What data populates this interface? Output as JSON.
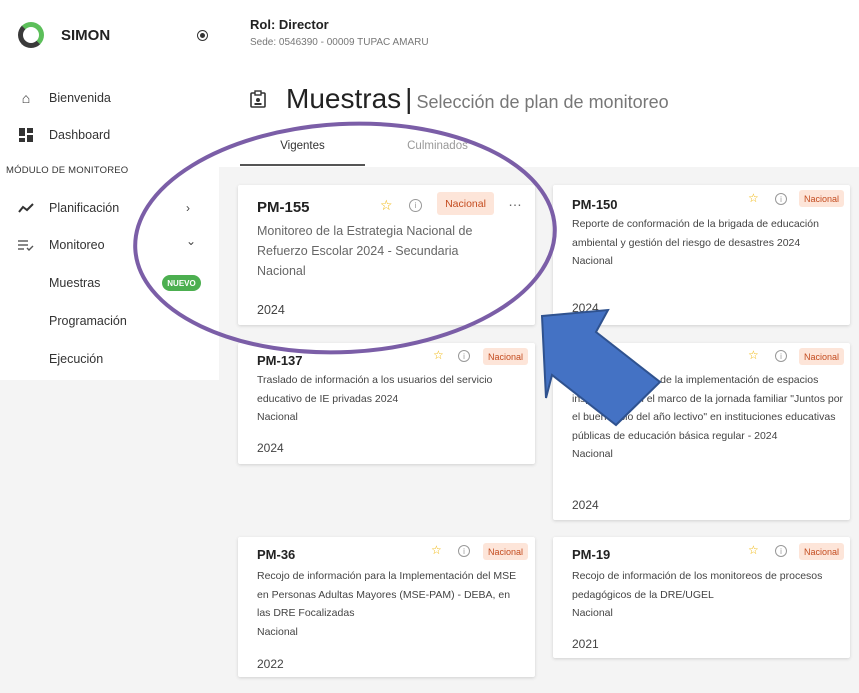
{
  "app": {
    "name": "SIMON"
  },
  "sidebar": {
    "items": [
      {
        "label": "Bienvenida",
        "icon": "home-icon"
      },
      {
        "label": "Dashboard",
        "icon": "dashboard-icon"
      }
    ],
    "section_label": "MÓDULO DE MONITOREO",
    "module_items": [
      {
        "label": "Planificación",
        "icon": "trend-icon",
        "chevron": "›"
      },
      {
        "label": "Monitoreo",
        "icon": "list-check-icon",
        "chevron": "⌄"
      }
    ],
    "sub_items": [
      {
        "label": "Muestras",
        "badge": "NUEVO"
      },
      {
        "label": "Programación"
      },
      {
        "label": "Ejecución"
      }
    ]
  },
  "header": {
    "role": "Rol: Director",
    "sede": "Sede: 0546390 - 00009 TUPAC AMARU",
    "title": "Muestras",
    "separator": "|",
    "subtitle": "Selección de plan de monitoreo"
  },
  "tabs": [
    {
      "label": "Vigentes",
      "active": true
    },
    {
      "label": "Culminados",
      "active": false
    }
  ],
  "cards": [
    {
      "code": "PM-155",
      "badge": "Nacional",
      "desc": "Monitoreo de la Estrategia Nacional de Refuerzo Escolar 2024 - Secundaria",
      "scope": "Nacional",
      "year": "2024"
    },
    {
      "code": "PM-150",
      "badge": "Nacional",
      "desc": "Reporte de conformación de la brigada de educación ambiental y gestión del riesgo de desastres 2024",
      "scope": "Nacional",
      "year": "2024"
    },
    {
      "code": "PM-137",
      "badge": "Nacional",
      "desc": "Traslado de información a los usuarios del servicio educativo de IE privadas 2024",
      "scope": "Nacional",
      "year": "2024"
    },
    {
      "code": "",
      "badge": "Nacional",
      "desc": "Plan de monitoreo de la implementación de espacios inspiradores en el marco de la jornada familiar \"Juntos por el buen inicio del año lectivo\" en instituciones educativas públicas de educación básica regular - 2024",
      "scope": "Nacional",
      "year": "2024"
    },
    {
      "code": "PM-36",
      "badge": "Nacional",
      "desc": "Recojo de información para la Implementación del MSE en Personas Adultas Mayores (MSE-PAM) - DEBA, en las DRE Focalizadas",
      "scope": "Nacional",
      "year": "2022"
    },
    {
      "code": "PM-19",
      "badge": "Nacional",
      "desc": "Recojo de información de los monitoreos de procesos pedagógicos de la DRE/UGEL",
      "scope": "Nacional",
      "year": "2021"
    }
  ],
  "colors": {
    "annotation_purple": "#7b5ea7",
    "annotation_arrow": "#4472c4",
    "badge_bg": "#fde5d9",
    "badge_text": "#c44c1f",
    "new_badge": "#4caf50",
    "star": "#f0b400"
  }
}
